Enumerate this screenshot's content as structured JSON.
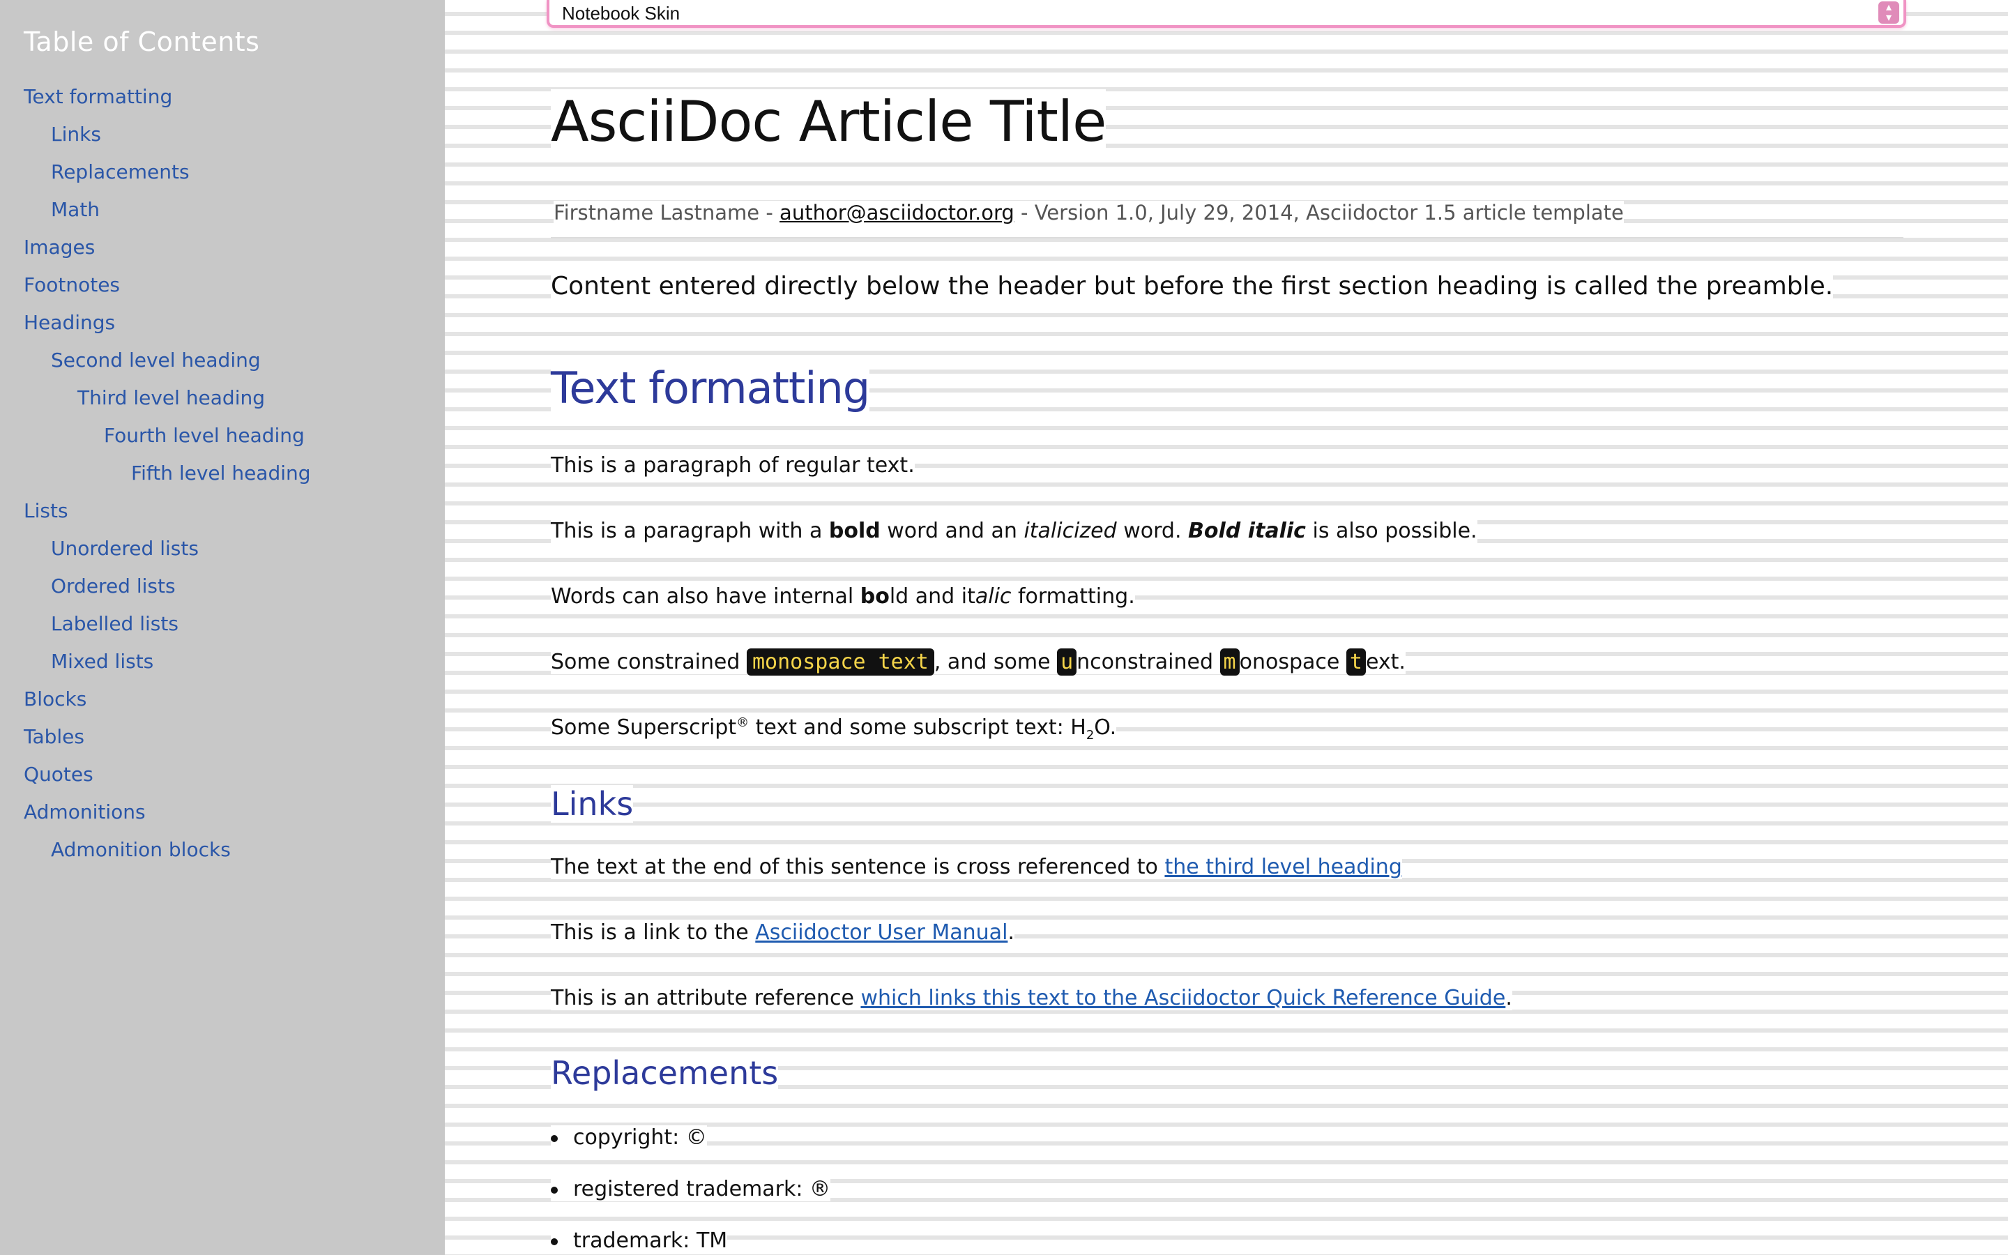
{
  "sidebar": {
    "title": "Table of Contents",
    "items": [
      {
        "label": "Text formatting",
        "level": 0
      },
      {
        "label": "Links",
        "level": 1
      },
      {
        "label": "Replacements",
        "level": 1
      },
      {
        "label": "Math",
        "level": 1
      },
      {
        "label": "Images",
        "level": 0
      },
      {
        "label": "Footnotes",
        "level": 0
      },
      {
        "label": "Headings",
        "level": 0
      },
      {
        "label": "Second level heading",
        "level": 1
      },
      {
        "label": "Third level heading",
        "level": 2
      },
      {
        "label": "Fourth level heading",
        "level": 3
      },
      {
        "label": "Fifth level heading",
        "level": 4
      },
      {
        "label": "Lists",
        "level": 0
      },
      {
        "label": "Unordered lists",
        "level": 1
      },
      {
        "label": "Ordered lists",
        "level": 1
      },
      {
        "label": "Labelled lists",
        "level": 1
      },
      {
        "label": "Mixed lists",
        "level": 1
      },
      {
        "label": "Blocks",
        "level": 0
      },
      {
        "label": "Tables",
        "level": 0
      },
      {
        "label": "Quotes",
        "level": 0
      },
      {
        "label": "Admonitions",
        "level": 0
      },
      {
        "label": "Admonition blocks",
        "level": 1
      }
    ]
  },
  "skin_select": {
    "value": "Notebook Skin"
  },
  "header": {
    "title": "AsciiDoc Article Title",
    "author": "Firstname Lastname",
    "sep1": " - ",
    "email": "author@asciidoctor.org",
    "revision": " - Version 1.0, July 29, 2014, Asciidoctor 1.5 article template"
  },
  "preamble": "Content entered directly below the header but before the first section heading is called the preamble.",
  "text_formatting": {
    "heading": "Text formatting",
    "p1": "This is a paragraph of regular text.",
    "p2": {
      "a": "This is a paragraph with a ",
      "bold": "bold",
      "b": " word and an ",
      "italic": "italicized",
      "c": " word. ",
      "bolditalic": "Bold italic",
      "d": " is also possible."
    },
    "p3": {
      "a": "Words can also have internal ",
      "b1": "bo",
      "b2": "ld",
      "c": " and ",
      "i1": "it",
      "i2": "alic",
      "d": " formatting."
    },
    "p4": {
      "a": "Some constrained ",
      "mono1": "monospace text",
      "b": ", and some ",
      "m1": "u",
      "c": "nconstrained ",
      "m2": "m",
      "d": "onospace ",
      "m3": "t",
      "e": "ext."
    },
    "p5": {
      "a": "Some Superscript",
      "sup": "®",
      "b": " text and some subscript text: H",
      "sub": "2",
      "c": "O."
    }
  },
  "links": {
    "heading": "Links",
    "p1": {
      "a": "The text at the end of this sentence is cross referenced to ",
      "link": "the third level heading"
    },
    "p2": {
      "a": "This is a link to the ",
      "link": "Asciidoctor User Manual",
      "b": "."
    },
    "p3": {
      "a": "This is an attribute reference ",
      "link": "which links this text to the Asciidoctor Quick Reference Guide",
      "b": "."
    }
  },
  "replacements": {
    "heading": "Replacements",
    "items": [
      "copyright: ©",
      "registered trademark: ®",
      "trademark: TM"
    ]
  },
  "colors": {
    "sidebar_bg": "#c8c8c8",
    "link": "#1f5bb0",
    "heading": "#2d3a9a",
    "mono_bg": "#111111",
    "mono_fg": "#f5d54a",
    "select_border": "#f093c4"
  }
}
